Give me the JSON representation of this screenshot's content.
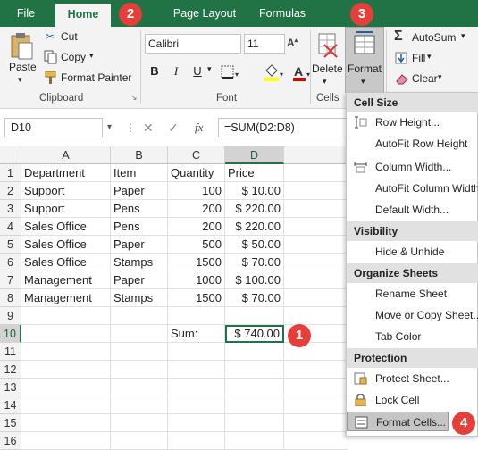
{
  "tabs": [
    "File",
    "Home",
    "rt",
    "Page Layout",
    "Formulas"
  ],
  "clipboard": {
    "paste": "Paste",
    "cut": "Cut",
    "copy": "Copy",
    "format_painter": "Format Painter",
    "label": "Clipboard"
  },
  "font": {
    "name": "Calibri",
    "size": "11",
    "label": "Font",
    "bold": "B",
    "italic": "I",
    "underline": "U"
  },
  "cells_group": {
    "delete": "Delete",
    "format": "Format",
    "label": "Cells"
  },
  "editing": {
    "autosum": "AutoSum",
    "fill": "Fill",
    "clear": "Clear"
  },
  "formula_bar": {
    "name_box": "D10",
    "fx": "fx",
    "formula": "=SUM(D2:D8)"
  },
  "columns": [
    "A",
    "B",
    "C",
    "D"
  ],
  "rows": [
    "1",
    "2",
    "3",
    "4",
    "5",
    "6",
    "7",
    "8",
    "9",
    "10",
    "11",
    "12",
    "13",
    "14",
    "15",
    "16"
  ],
  "table": {
    "header": [
      "Department",
      "Item",
      "Quantity",
      "Price"
    ],
    "rows": [
      [
        "Support",
        "Paper",
        "100",
        "$   10.00"
      ],
      [
        "Support",
        "Pens",
        "200",
        "$ 220.00"
      ],
      [
        "Sales Office",
        "Pens",
        "200",
        "$ 220.00"
      ],
      [
        "Sales Office",
        "Paper",
        "500",
        "$   50.00"
      ],
      [
        "Sales Office",
        "Stamps",
        "1500",
        "$   70.00"
      ],
      [
        "Management",
        "Paper",
        "1000",
        "$ 100.00"
      ],
      [
        "Management",
        "Stamps",
        "1500",
        "$   70.00"
      ]
    ],
    "sum_label": "Sum:",
    "sum_value": "$ 740.00"
  },
  "menu": {
    "cell_size": "Cell Size",
    "row_height": "Row Height...",
    "autofit_row": "AutoFit Row Height",
    "column_width": "Column Width...",
    "autofit_col": "AutoFit Column Width",
    "default_width": "Default Width...",
    "visibility": "Visibility",
    "hide_unhide": "Hide & Unhide",
    "organize": "Organize Sheets",
    "rename": "Rename Sheet",
    "move_copy": "Move or Copy Sheet...",
    "tab_color": "Tab Color",
    "protection": "Protection",
    "protect_sheet": "Protect Sheet...",
    "lock_cell": "Lock Cell",
    "format_cells": "Format Cells..."
  },
  "badges": [
    "1",
    "2",
    "3",
    "4"
  ],
  "colors": {
    "excel_green": "#217346",
    "badge_red": "#e43f3a",
    "highlight": "#cfe8d9"
  }
}
